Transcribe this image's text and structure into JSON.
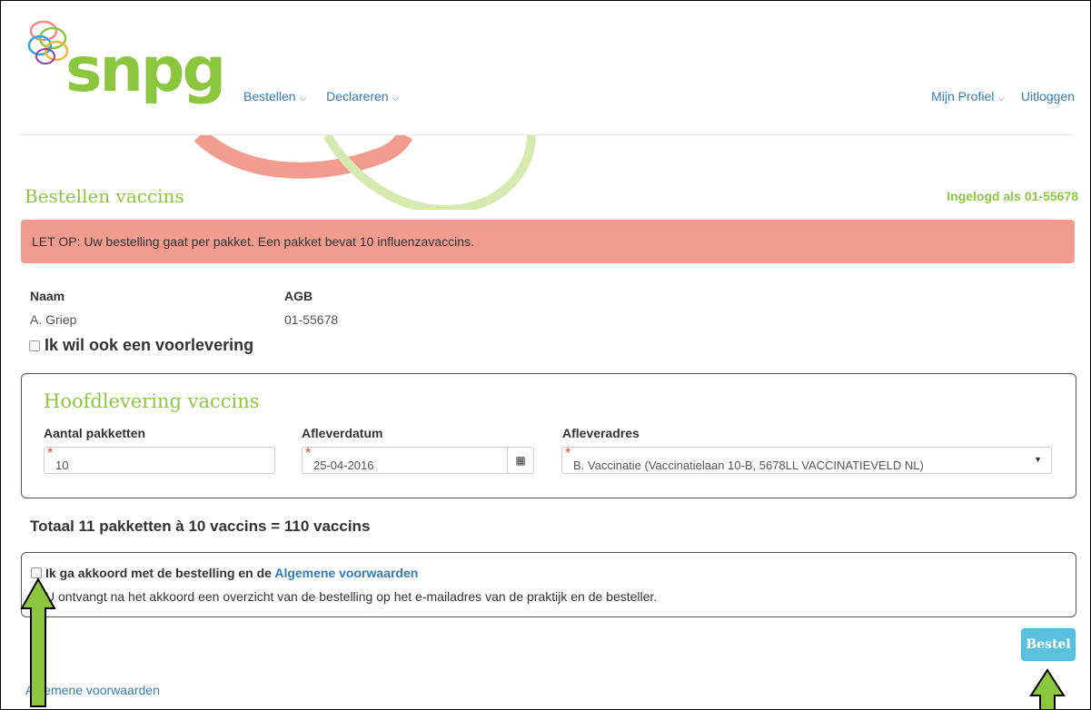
{
  "brand": {
    "logo_text": "snpg",
    "accent": "#8cc63f",
    "alert_bg": "#f19c8e",
    "link": "#337ab7",
    "button": "#5bc0de"
  },
  "nav": {
    "left": [
      {
        "label": "Bestellen"
      },
      {
        "label": "Declareren"
      }
    ],
    "right": [
      {
        "label": "Mijn Profiel"
      },
      {
        "label": "Uitloggen"
      }
    ]
  },
  "page": {
    "title": "Bestellen vaccins",
    "logged_in": "Ingelogd als 01-55678"
  },
  "alert": {
    "text": "LET OP: Uw bestelling gaat per pakket. Een pakket bevat 10 influenzavaccins."
  },
  "customer": {
    "name_label": "Naam",
    "name_value": "A. Griep",
    "agb_label": "AGB",
    "agb_value": "01-55678",
    "voorlevering_label": "Ik wil ook een voorlevering"
  },
  "hoofdlevering": {
    "title": "Hoofdlevering vaccins",
    "aantal_label": "Aantal pakketten",
    "aantal_value": "10",
    "datum_label": "Afleverdatum",
    "datum_value": "25-04-2016",
    "adres_label": "Afleveradres",
    "adres_value": "B. Vaccinatie (Vaccinatielaan 10-B, 5678LL VACCINATIEVELD NL)"
  },
  "totaal": {
    "text": "Totaal 11 pakketten à 10 vaccins = 110 vaccins"
  },
  "akkoord": {
    "label": "Ik ga akkoord met de bestelling en de",
    "link": "Algemene voorwaarden",
    "info": "U ontvangt na het akkoord een overzicht van de bestelling op het e-mailadres van de praktijk en de besteller."
  },
  "actions": {
    "bestel_label": "Bestel"
  },
  "footer": {
    "link": "Algemene voorwaarden"
  }
}
